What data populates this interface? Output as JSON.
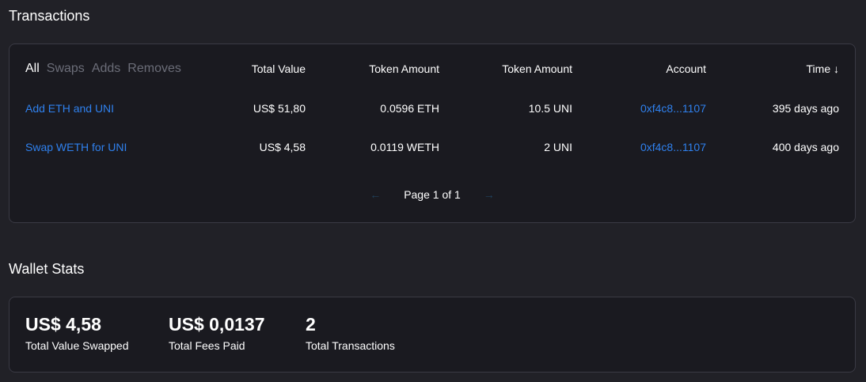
{
  "transactions": {
    "title": "Transactions",
    "filters": [
      "All",
      "Swaps",
      "Adds",
      "Removes"
    ],
    "active_filter": "All",
    "columns": {
      "total_value": "Total Value",
      "token_amount_1": "Token Amount",
      "token_amount_2": "Token Amount",
      "account": "Account",
      "time": "Time ↓"
    },
    "rows": [
      {
        "name": "Add ETH and UNI",
        "total_value": "US$ 51,80",
        "token_amount_1": "0.0596 ETH",
        "token_amount_2": "10.5 UNI",
        "account": "0xf4c8...1107",
        "time": "395 days ago"
      },
      {
        "name": "Swap WETH for UNI",
        "total_value": "US$ 4,58",
        "token_amount_1": "0.0119 WETH",
        "token_amount_2": "2 UNI",
        "account": "0xf4c8...1107",
        "time": "400 days ago"
      }
    ],
    "pagination": {
      "prev_icon": "←",
      "next_icon": "→",
      "label": "Page 1 of 1"
    }
  },
  "wallet_stats": {
    "title": "Wallet Stats",
    "stats": [
      {
        "value": "US$ 4,58",
        "label": "Total Value Swapped"
      },
      {
        "value": "US$ 0,0137",
        "label": "Total Fees Paid"
      },
      {
        "value": "2",
        "label": "Total Transactions"
      }
    ]
  },
  "colors": {
    "background": "#212127",
    "panel": "#1a1a20",
    "link": "#2f80ed",
    "muted": "#6b6d78"
  }
}
